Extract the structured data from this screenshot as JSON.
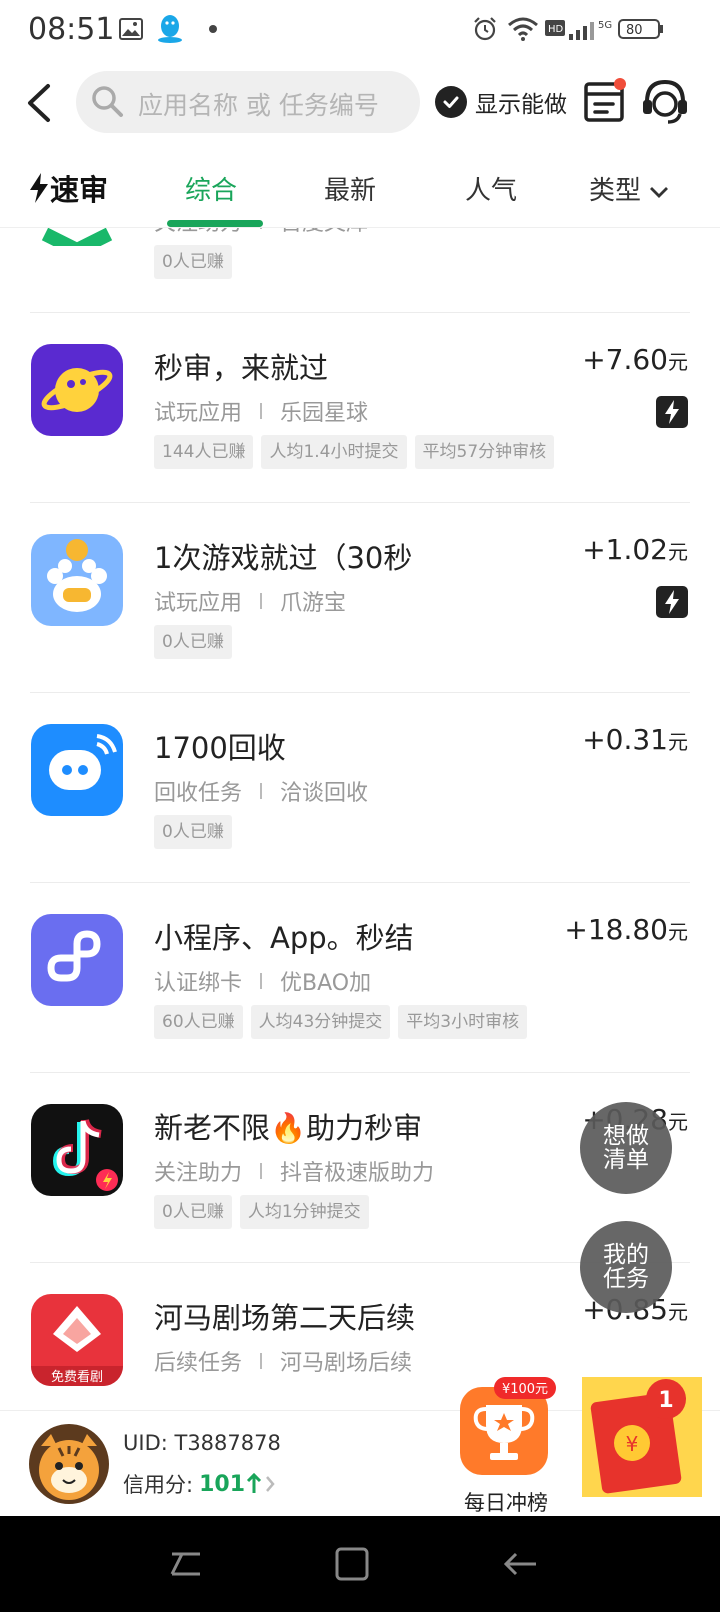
{
  "status_bar": {
    "time": "08:51",
    "battery": "80"
  },
  "header": {
    "search_placeholder": "应用名称 或 任务编号",
    "show_can_do_label": "显示能做"
  },
  "tabs": {
    "logo_label": "速审",
    "items": [
      "综合",
      "最新",
      "人气",
      "类型"
    ],
    "active_index": 0,
    "accent_color": "#19a55a"
  },
  "tasks": [
    {
      "title": "",
      "category": "关注助力",
      "app": "百度文库",
      "tags": [
        "0人已赚"
      ],
      "price": "",
      "unit": "",
      "fast": false
    },
    {
      "title": "秒审，来就过",
      "category": "试玩应用",
      "app": "乐园星球",
      "tags": [
        "144人已赚",
        "人均1.4小时提交",
        "平均57分钟审核"
      ],
      "price": "+7.60",
      "unit": "元",
      "fast": true
    },
    {
      "title": "1次游戏就过（30秒",
      "category": "试玩应用",
      "app": "爪游宝",
      "tags": [
        "0人已赚"
      ],
      "price": "+1.02",
      "unit": "元",
      "fast": true
    },
    {
      "title": "1700回收",
      "category": "回收任务",
      "app": "洽谈回收",
      "tags": [
        "0人已赚"
      ],
      "price": "+0.31",
      "unit": "元",
      "fast": false
    },
    {
      "title": "小程序、App。秒结",
      "category": "认证绑卡",
      "app": "优BAO加",
      "tags": [
        "60人已赚",
        "人均43分钟提交",
        "平均3小时审核"
      ],
      "price": "+18.80",
      "unit": "元",
      "fast": false
    },
    {
      "title": "新老不限🔥助力秒审",
      "category": "关注助力",
      "app": "抖音极速版助力",
      "tags": [
        "0人已赚",
        "人均1分钟提交"
      ],
      "price": "+0.28",
      "unit": "元",
      "fast": false
    },
    {
      "title": "河马剧场第二天后续",
      "category": "后续任务",
      "app": "河马剧场后续",
      "tags": [],
      "price": "+0.85",
      "unit": "元",
      "fast": false
    }
  ],
  "icon_badge_text": "免费看剧",
  "float_buttons": {
    "wishlist": "想做清单",
    "my_tasks": "我的任务"
  },
  "user_bar": {
    "uid": "UID: T3887878",
    "credit_label": "信用分:",
    "credit_value": "101",
    "daily_rank_label": "每日冲榜",
    "daily_rank_badge": "¥100元",
    "redpack_count": "1"
  }
}
